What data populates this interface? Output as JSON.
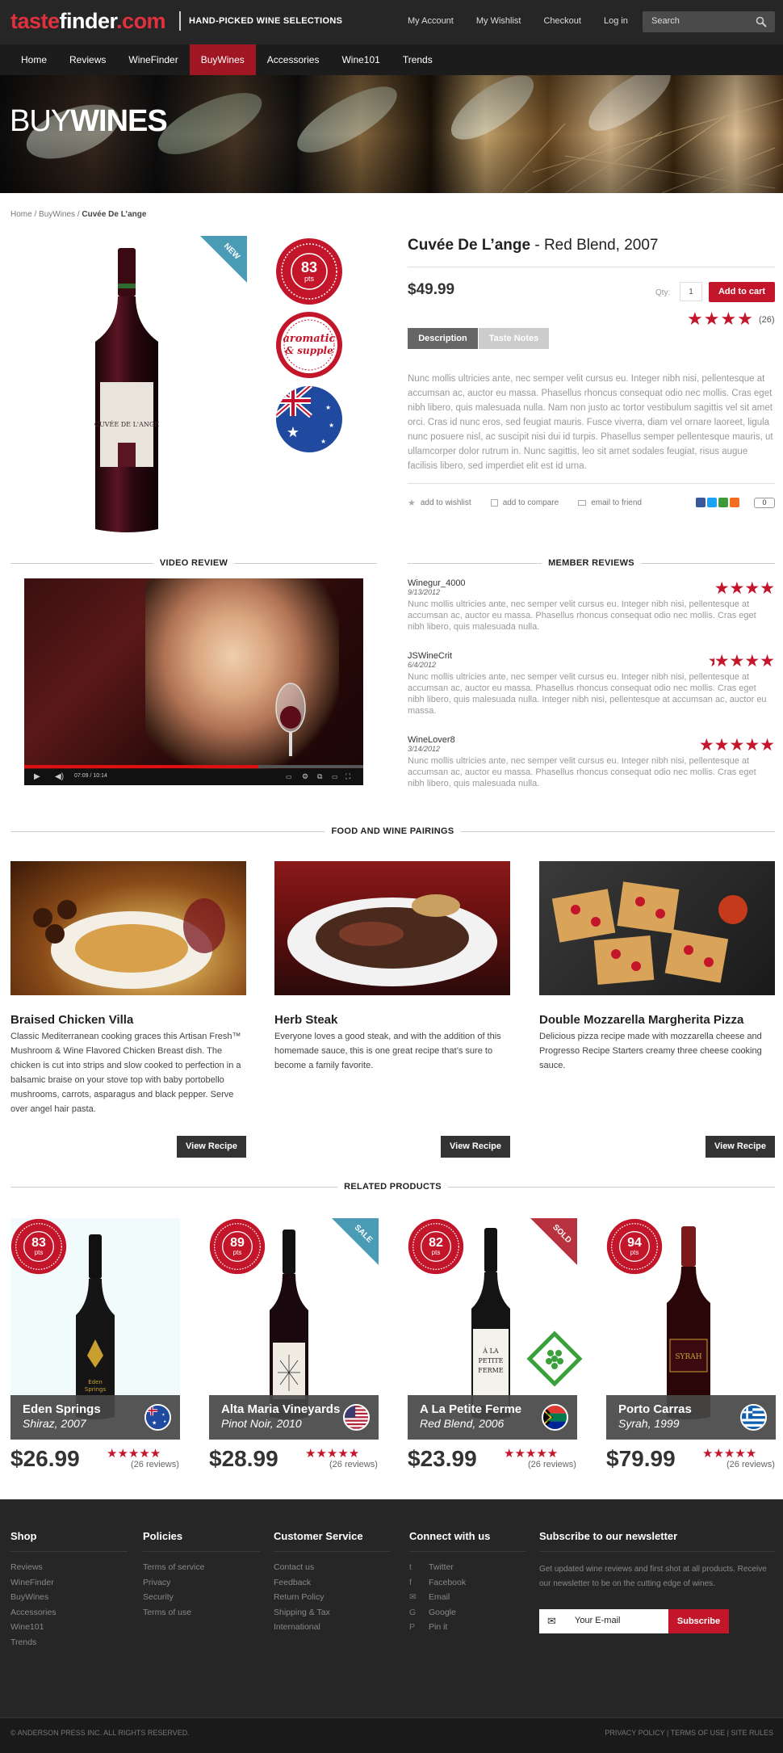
{
  "header": {
    "logo": {
      "part1": "taste",
      "part2": "finder",
      "part3": ".com"
    },
    "tagline": "HAND-PICKED WINE SELECTIONS",
    "links": [
      "My Account",
      "My Wishlist",
      "Checkout",
      "Log in"
    ],
    "search_placeholder": "Search"
  },
  "nav": {
    "items": [
      "Home",
      "Reviews",
      "WineFinder",
      "BuyWines",
      "Accessories",
      "Wine101",
      "Trends"
    ],
    "active": "BuyWines"
  },
  "hero": {
    "title_thin": "BUY",
    "title_bold": "WINES"
  },
  "breadcrumb": {
    "home": "Home",
    "sep1": " / ",
    "section": "BuyWines",
    "sep2": " / ",
    "current": "Cuvée De L’ange"
  },
  "product": {
    "ribbon": "NEW",
    "score": "83",
    "score_unit": "pts",
    "badge_line1": "aromatic",
    "badge_line2": "& supple",
    "name": "Cuvée De L’ange",
    "subtitle": " - Red Blend, 2007",
    "price": "$49.99",
    "qty_label": "Qty:",
    "qty_value": "1",
    "add_to_cart": "Add to cart",
    "rating": 4,
    "rating_count": "(26)",
    "tabs": [
      "Description",
      "Taste Notes"
    ],
    "description": "Nunc mollis ultricies ante, nec semper velit cursus eu. Integer nibh nisi, pellentesque at accumsan ac, auctor eu massa. Phasellus rhoncus consequat odio nec mollis. Cras eget nibh libero, quis malesuada nulla. Nam non justo ac tortor vestibulum sagittis vel sit amet orci. Cras id nunc eros, sed feugiat mauris. Fusce viverra, diam vel ornare laoreet, ligula nunc posuere nisl, ac suscipit nisi dui id turpis. Phasellus semper pellentesque mauris, ut ullamcorper dolor rutrum in. Nunc sagittis, leo sit amet sodales feugiat, risus augue facilisis libero, sed imperdiet elit est id urna.",
    "actions": [
      "add to wishlist",
      "add to compare",
      "email to friend"
    ],
    "share_count": "0"
  },
  "video": {
    "heading": "VIDEO REVIEW",
    "time": "07:09 / 10:14",
    "progress": 0.69
  },
  "reviews": {
    "heading": "MEMBER REVIEWS",
    "items": [
      {
        "name": "Winegur_4000",
        "date": "9/13/2012",
        "stars": 4,
        "text": "Nunc mollis ultricies ante, nec semper velit cursus eu. Integer nibh nisi, pellentesque at accumsan ac, auctor eu massa. Phasellus rhoncus consequat odio nec mollis. Cras eget nibh libero, quis malesuada nulla."
      },
      {
        "name": "JSWineCrit",
        "date": "6/4/2012",
        "stars": 4.5,
        "text": "Nunc mollis ultricies ante, nec semper velit cursus eu. Integer nibh nisi, pellentesque at accumsan ac, auctor eu massa. Phasellus rhoncus consequat odio nec mollis. Cras eget nibh libero, quis malesuada nulla.  Integer nibh nisi, pellentesque at accumsan ac, auctor eu massa."
      },
      {
        "name": "WineLover8",
        "date": "3/14/2012",
        "stars": 5,
        "text": "Nunc mollis ultricies ante, nec semper velit cursus eu. Integer nibh nisi, pellentesque at accumsan ac, auctor eu massa. Phasellus rhoncus consequat odio nec mollis. Cras eget nibh libero, quis malesuada nulla."
      }
    ]
  },
  "pairings": {
    "heading": "FOOD AND WINE PAIRINGS",
    "button": "View Recipe",
    "items": [
      {
        "title": "Braised Chicken Villa",
        "text": "Classic Mediterranean cooking graces this Artisan Fresh™ Mushroom & Wine Flavored Chicken Breast dish. The chicken is cut into strips and slow cooked to perfection in a balsamic braise on your stove top with baby portobello mushrooms, carrots, asparagus and black pepper. Serve over angel hair pasta."
      },
      {
        "title": "Herb Steak",
        "text": "Everyone loves a good steak, and with the addition of this homemade sauce, this is one great recipe that’s sure to become a family favorite."
      },
      {
        "title": "Double Mozzarella Margherita Pizza",
        "text": "Delicious pizza recipe made with mozzarella cheese and Progresso Recipe Starters creamy three cheese cooking sauce."
      }
    ]
  },
  "related": {
    "heading": "RELATED PRODUCTS",
    "score_unit": "pts",
    "items": [
      {
        "score": "83",
        "name": "Eden Springs",
        "sub": "Shiraz, 2007",
        "price": "$26.99",
        "stars": 5,
        "reviews": "(26 reviews)",
        "ribbon": "",
        "flag": "australia"
      },
      {
        "score": "89",
        "name": "Alta Maria Vineyards",
        "sub": "Pinot Noir, 2010",
        "price": "$28.99",
        "stars": 5,
        "reviews": "(26 reviews)",
        "ribbon": "SALE",
        "flag": "usa"
      },
      {
        "score": "82",
        "name": "A La Petite Ferme",
        "sub": "Red Blend, 2006",
        "price": "$23.99",
        "stars": 5,
        "reviews": "(26 reviews)",
        "ribbon": "SOLD",
        "flag": "south-africa"
      },
      {
        "score": "94",
        "name": "Porto Carras",
        "sub": "Syrah, 1999",
        "price": "$79.99",
        "stars": 5,
        "reviews": "(26 reviews)",
        "ribbon": "",
        "flag": "greece"
      }
    ]
  },
  "footer": {
    "shop": {
      "title": "Shop",
      "links": [
        "Reviews",
        "WineFinder",
        "BuyWines",
        "Accessories",
        "Wine101",
        "Trends"
      ]
    },
    "policies": {
      "title": "Policies",
      "links": [
        "Terms of service",
        "Privacy",
        "Security",
        "Terms of use"
      ]
    },
    "service": {
      "title": "Customer Service",
      "links": [
        "Contact us",
        "Feedback",
        "Return Policy",
        "Shipping & Tax",
        "International"
      ]
    },
    "connect": {
      "title": "Connect with us",
      "links": [
        "Twitter",
        "Facebook",
        "Email",
        "Google",
        "Pin it"
      ]
    },
    "newsletter": {
      "title": "Subscribe to our newsletter",
      "text": "Get updated wine reviews and first shot at all products. Receive our newsletter to be on the cutting edge of wines.",
      "placeholder": "Your E-mail",
      "button": "Subscribe"
    },
    "copyright": "© ANDERSON PRESS INC.   ALL RIGHTS RESERVED.",
    "bottom_links": "PRIVACY POLICY | TERMS OF USE | SITE RULES"
  },
  "colors": {
    "accent": "#c4162a",
    "dark": "#262626",
    "nav_active": "#a11623",
    "teal_ribbon": "#4a9bb5"
  }
}
